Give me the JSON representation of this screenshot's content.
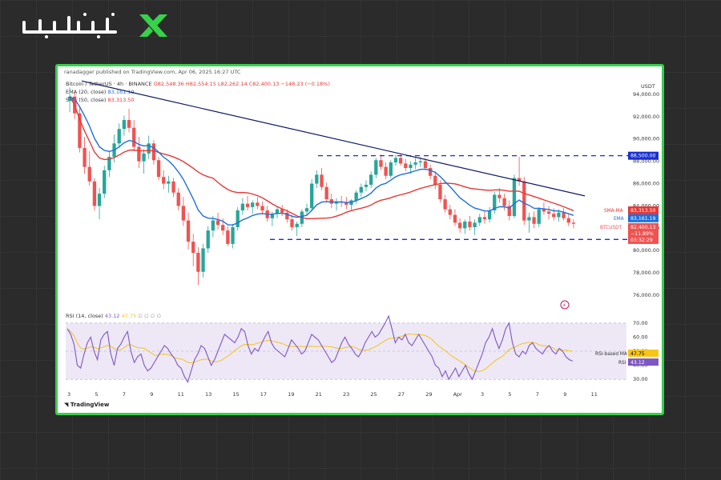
{
  "brand": {
    "name": "تیوبیت"
  },
  "publisher": "ranadagger published on TradingView.com, Apr 06, 2025 16:27 UTC",
  "symbol_line": {
    "symbol": "Bitcoin / TetherUS · 4h · BINANCE",
    "o": "O82,548.36",
    "h": "H82,554.15",
    "l": "L82,262.14",
    "c": "C82,400.13",
    "chg": "−148.23 (−0.18%)"
  },
  "ema_line": {
    "label": "EMA (20, close)",
    "value": "83,161.19"
  },
  "sma_line": {
    "label": "SMA (50, close)",
    "value": "83,313.50"
  },
  "rsi_line": {
    "label": "RSI (14, close)",
    "v1": "43.12",
    "v2": "47.75",
    "rest": "∅ ∅ ∅ ∅"
  },
  "footer": "TradingView",
  "chart_data": {
    "type": "candlestick",
    "currency": "USDT",
    "ylim": [
      75000,
      95500
    ],
    "y_ticks": [
      "94,000.00",
      "92,000.00",
      "90,000.00",
      "88,000.00",
      "86,000.00",
      "84,000.00",
      "82,000.00",
      "80,000.00",
      "78,000.00",
      "76,000.00"
    ],
    "x_ticks": [
      "3",
      "5",
      "7",
      "9",
      "11",
      "13",
      "15",
      "17",
      "19",
      "21",
      "23",
      "25",
      "27",
      "29",
      "Apr",
      "3",
      "5",
      "7",
      "9",
      "11"
    ],
    "support": "81,000.00",
    "resistance": "88,500.00",
    "last_price": {
      "label": "BTCUSDT",
      "value": "82,400.13",
      "change": "−11.89%",
      "countdown": "03:32:29"
    },
    "sma_tag": {
      "label": "SMA-MA",
      "value": "83,313.50"
    },
    "ema_tag": {
      "label": "EMA",
      "value": "83,161.19"
    },
    "rsi": {
      "ticks": [
        "70.00",
        "60.00",
        "50.00",
        "40.00",
        "30.00"
      ],
      "rsi_ma_label": "RSI-based MA",
      "rsi_ma": "47.75",
      "rsi_label": "RSI",
      "rsi_value": "43.12",
      "series": [
        66,
        62,
        55,
        40,
        38,
        48,
        56,
        60,
        50,
        44,
        58,
        62,
        64,
        48,
        40,
        52,
        55,
        60,
        64,
        50,
        42,
        46,
        48,
        40,
        36,
        38,
        42,
        46,
        50,
        54,
        52,
        48,
        45,
        40,
        38,
        32,
        28,
        36,
        44,
        48,
        54,
        52,
        46,
        40,
        44,
        50,
        56,
        62,
        60,
        58,
        56,
        60,
        66,
        64,
        54,
        48,
        52,
        50,
        55,
        60,
        64,
        56,
        52,
        50,
        48,
        46,
        52,
        58,
        55,
        52,
        48,
        50,
        56,
        62,
        60,
        58,
        54,
        50,
        46,
        42,
        44,
        50,
        56,
        60,
        55,
        52,
        48,
        46,
        50,
        56,
        60,
        64,
        60,
        62,
        66,
        70,
        75,
        66,
        56,
        60,
        58,
        62,
        56,
        54,
        58,
        62,
        58,
        54,
        50,
        46,
        40,
        38,
        32,
        36,
        30,
        34,
        38,
        32,
        36,
        40,
        34,
        30,
        36,
        42,
        48,
        56,
        60,
        66,
        58,
        52,
        58,
        66,
        70,
        56,
        48,
        46,
        50,
        48,
        54,
        56,
        52,
        50,
        48,
        52,
        54,
        50,
        48,
        52,
        50,
        46,
        44,
        43
      ]
    },
    "ohlc": [
      [
        93400,
        94600,
        92400,
        93800
      ],
      [
        93800,
        94200,
        91800,
        92300
      ],
      [
        92300,
        93000,
        88800,
        89200
      ],
      [
        89200,
        90200,
        86900,
        87500
      ],
      [
        87500,
        88900,
        85800,
        86200
      ],
      [
        86200,
        86500,
        83600,
        84000
      ],
      [
        84000,
        85600,
        82800,
        85100
      ],
      [
        85100,
        87600,
        84700,
        87200
      ],
      [
        87200,
        88900,
        86600,
        88400
      ],
      [
        88400,
        90400,
        87900,
        89600
      ],
      [
        89600,
        91400,
        89200,
        90900
      ],
      [
        90900,
        92100,
        90300,
        91700
      ],
      [
        91700,
        92700,
        90600,
        91000
      ],
      [
        91000,
        91700,
        88900,
        89300
      ],
      [
        89300,
        90200,
        87400,
        88000
      ],
      [
        88000,
        89100,
        86900,
        88700
      ],
      [
        88700,
        90300,
        88200,
        89600
      ],
      [
        89600,
        89900,
        87700,
        88100
      ],
      [
        88100,
        88400,
        86300,
        86600
      ],
      [
        86600,
        87200,
        85500,
        86000
      ],
      [
        86000,
        86700,
        85200,
        86200
      ],
      [
        86200,
        86500,
        84800,
        85200
      ],
      [
        85200,
        85600,
        83600,
        84000
      ],
      [
        84000,
        84800,
        82200,
        82700
      ],
      [
        82700,
        83400,
        80100,
        80800
      ],
      [
        80800,
        81500,
        78600,
        79800
      ],
      [
        79800,
        80300,
        76900,
        78100
      ],
      [
        78100,
        80600,
        77600,
        80200
      ],
      [
        80200,
        82200,
        79800,
        81800
      ],
      [
        81800,
        83100,
        81200,
        82700
      ],
      [
        82700,
        83400,
        81900,
        82300
      ],
      [
        82300,
        82900,
        81400,
        81800
      ],
      [
        81800,
        82200,
        80400,
        80600
      ],
      [
        80600,
        82400,
        80200,
        82100
      ],
      [
        82100,
        83900,
        81800,
        83600
      ],
      [
        83600,
        84700,
        83200,
        84200
      ],
      [
        84200,
        84900,
        83600,
        83900
      ],
      [
        83900,
        84500,
        83300,
        84300
      ],
      [
        84300,
        84800,
        83700,
        84000
      ],
      [
        84000,
        84400,
        83200,
        83600
      ],
      [
        83600,
        84000,
        82600,
        82900
      ],
      [
        82900,
        83500,
        82200,
        83300
      ],
      [
        83300,
        83900,
        82900,
        83700
      ],
      [
        83700,
        84100,
        83100,
        83400
      ],
      [
        83400,
        83700,
        82500,
        82800
      ],
      [
        82800,
        83200,
        81800,
        82100
      ],
      [
        82100,
        82600,
        81300,
        82400
      ],
      [
        82400,
        83700,
        82100,
        83500
      ],
      [
        83500,
        84200,
        83100,
        83800
      ],
      [
        83800,
        86400,
        83500,
        86000
      ],
      [
        86000,
        87200,
        85600,
        86800
      ],
      [
        86800,
        87400,
        85400,
        85700
      ],
      [
        85700,
        86100,
        84300,
        84600
      ],
      [
        84600,
        85100,
        83800,
        84200
      ],
      [
        84200,
        84700,
        83600,
        84400
      ],
      [
        84400,
        84900,
        83900,
        84300
      ],
      [
        84300,
        84800,
        83700,
        84100
      ],
      [
        84100,
        84600,
        83600,
        84500
      ],
      [
        84500,
        85400,
        84200,
        85200
      ],
      [
        85200,
        86000,
        84800,
        85700
      ],
      [
        85700,
        86300,
        85300,
        85900
      ],
      [
        85900,
        87100,
        85600,
        86800
      ],
      [
        86800,
        88300,
        86500,
        88100
      ],
      [
        88100,
        88600,
        87200,
        87500
      ],
      [
        87500,
        87900,
        86400,
        86700
      ],
      [
        86700,
        88100,
        86500,
        87900
      ],
      [
        87900,
        88600,
        87600,
        88300
      ],
      [
        88300,
        88700,
        87600,
        87800
      ],
      [
        87800,
        88200,
        87100,
        87400
      ],
      [
        87400,
        88000,
        86900,
        87700
      ],
      [
        87700,
        88300,
        87300,
        87900
      ],
      [
        87900,
        88400,
        87500,
        88000
      ],
      [
        88000,
        88300,
        87200,
        87400
      ],
      [
        87400,
        87700,
        86400,
        86700
      ],
      [
        86700,
        87100,
        85500,
        85900
      ],
      [
        85900,
        86300,
        84300,
        84600
      ],
      [
        84600,
        85000,
        83400,
        83700
      ],
      [
        83700,
        84100,
        82800,
        83200
      ],
      [
        83200,
        83700,
        82200,
        82500
      ],
      [
        82500,
        82900,
        81600,
        82000
      ],
      [
        82000,
        82800,
        81500,
        82600
      ],
      [
        82600,
        83100,
        81800,
        82100
      ],
      [
        82100,
        82800,
        81400,
        82500
      ],
      [
        82500,
        83300,
        82200,
        83000
      ],
      [
        83000,
        83600,
        82400,
        82800
      ],
      [
        82800,
        83900,
        82500,
        83600
      ],
      [
        83600,
        85300,
        83300,
        85000
      ],
      [
        85000,
        85600,
        84300,
        84700
      ],
      [
        84700,
        85100,
        83600,
        84000
      ],
      [
        84000,
        84500,
        82700,
        83100
      ],
      [
        83100,
        86800,
        82900,
        86500
      ],
      [
        86500,
        88400,
        85800,
        86200
      ],
      [
        86200,
        86600,
        82300,
        82700
      ],
      [
        82700,
        83400,
        81600,
        83000
      ],
      [
        83000,
        83500,
        82000,
        82400
      ],
      [
        82400,
        83900,
        82100,
        83700
      ],
      [
        83700,
        84300,
        83200,
        83500
      ],
      [
        83500,
        84000,
        82800,
        83300
      ],
      [
        83300,
        83800,
        82700,
        83000
      ],
      [
        83000,
        83700,
        82600,
        83400
      ],
      [
        83400,
        83800,
        82700,
        82900
      ],
      [
        82900,
        83300,
        82200,
        82500
      ],
      [
        82500,
        82800,
        82000,
        82400
      ]
    ]
  }
}
